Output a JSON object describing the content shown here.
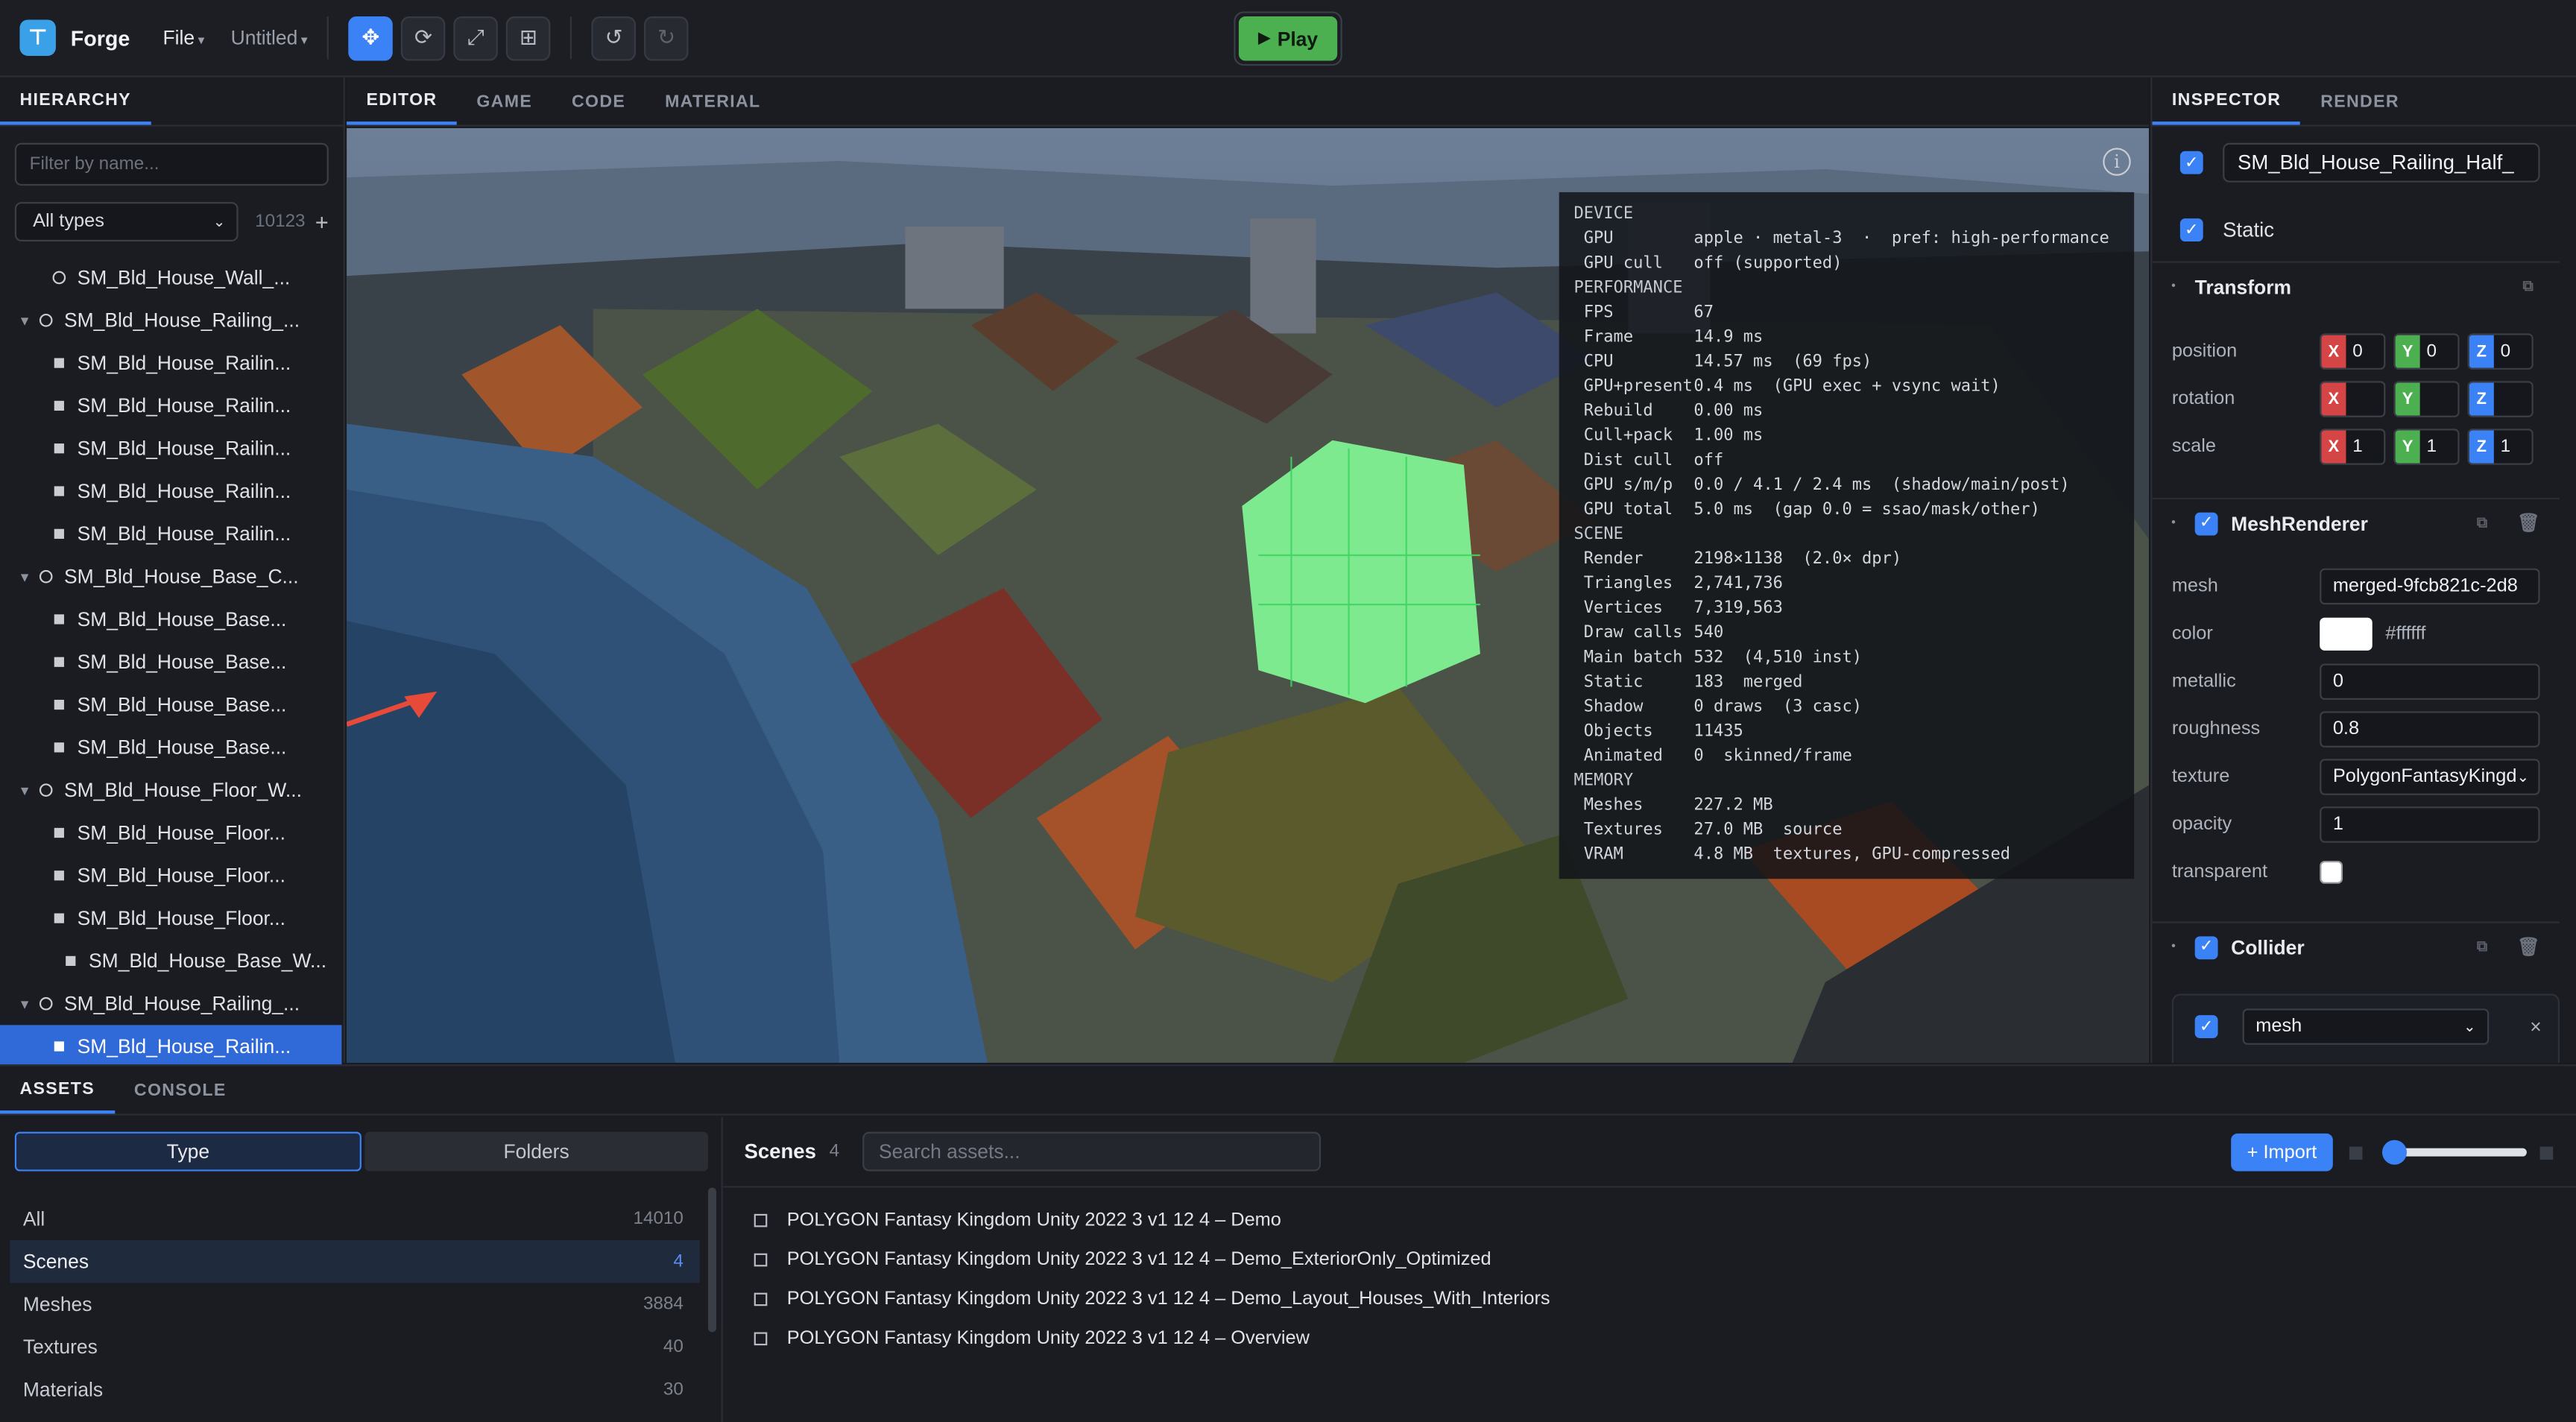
{
  "app": {
    "name": "Forge",
    "file_menu": "File",
    "document": "Untitled",
    "caret": "▾",
    "play_label": "Play",
    "play_icon": "▶",
    "tools": [
      {
        "name": "move-tool",
        "glyph": "✥",
        "active": true
      },
      {
        "name": "rotate-tool",
        "glyph": "⟳",
        "active": false
      },
      {
        "name": "scale-tool",
        "glyph": "⤢",
        "active": false
      },
      {
        "name": "rect-tool",
        "glyph": "⊞",
        "active": false
      }
    ],
    "undo": "↺",
    "redo": "↻",
    "accent": "#3b82f6",
    "play_color": "#4caf50"
  },
  "hierarchy": {
    "tab": "HIERARCHY",
    "filter_placeholder": "Filter by name...",
    "types_selected": "All types",
    "count": "10123",
    "add": "+",
    "rows": [
      {
        "label": "SM_Bld_House_Wall_...",
        "depth": 1,
        "kind": "node",
        "expanded": false
      },
      {
        "label": "SM_Bld_House_Railing_...",
        "depth": 0,
        "kind": "node",
        "expanded": true
      },
      {
        "label": "SM_Bld_House_Railin...",
        "depth": 1,
        "kind": "leaf"
      },
      {
        "label": "SM_Bld_House_Railin...",
        "depth": 1,
        "kind": "leaf"
      },
      {
        "label": "SM_Bld_House_Railin...",
        "depth": 1,
        "kind": "leaf"
      },
      {
        "label": "SM_Bld_House_Railin...",
        "depth": 1,
        "kind": "leaf"
      },
      {
        "label": "SM_Bld_House_Railin...",
        "depth": 1,
        "kind": "leaf"
      },
      {
        "label": "SM_Bld_House_Base_C...",
        "depth": 0,
        "kind": "node",
        "expanded": true
      },
      {
        "label": "SM_Bld_House_Base...",
        "depth": 1,
        "kind": "leaf"
      },
      {
        "label": "SM_Bld_House_Base...",
        "depth": 1,
        "kind": "leaf"
      },
      {
        "label": "SM_Bld_House_Base...",
        "depth": 1,
        "kind": "leaf"
      },
      {
        "label": "SM_Bld_House_Base...",
        "depth": 1,
        "kind": "leaf"
      },
      {
        "label": "SM_Bld_House_Floor_W...",
        "depth": 0,
        "kind": "node",
        "expanded": true
      },
      {
        "label": "SM_Bld_House_Floor...",
        "depth": 1,
        "kind": "leaf"
      },
      {
        "label": "SM_Bld_House_Floor...",
        "depth": 1,
        "kind": "leaf"
      },
      {
        "label": "SM_Bld_House_Floor...",
        "depth": 1,
        "kind": "leaf"
      },
      {
        "label": "SM_Bld_House_Base_W...",
        "depth": 0,
        "kind": "leaf"
      },
      {
        "label": "SM_Bld_House_Railing_...",
        "depth": 0,
        "kind": "node",
        "expanded": true
      },
      {
        "label": "SM_Bld_House_Railin...",
        "depth": 1,
        "kind": "leaf",
        "selected": true
      }
    ]
  },
  "editor": {
    "tabs": [
      "EDITOR",
      "GAME",
      "CODE",
      "MATERIAL"
    ],
    "info_icon": "i",
    "stats": [
      {
        "section": "DEVICE"
      },
      {
        "k": "GPU",
        "v": "apple · metal-3  ·  pref: high-performance"
      },
      {
        "k": "GPU cull",
        "v": "off (supported)"
      },
      {
        "section": "PERFORMANCE"
      },
      {
        "k": "FPS",
        "v": "67"
      },
      {
        "k": "Frame",
        "v": "14.9 ms"
      },
      {
        "k": "CPU",
        "v": "14.57 ms  (69 fps)"
      },
      {
        "k": "GPU+present",
        "v": "0.4 ms  (GPU exec + vsync wait)"
      },
      {
        "k": "Rebuild",
        "v": "0.00 ms"
      },
      {
        "k": "Cull+pack",
        "v": "1.00 ms"
      },
      {
        "k": "Dist cull",
        "v": "off"
      },
      {
        "k": "GPU s/m/p",
        "v": "0.0 / 4.1 / 2.4 ms  (shadow/main/post)"
      },
      {
        "k": "GPU total",
        "v": "5.0 ms  (gap 0.0 = ssao/mask/other)"
      },
      {
        "section": "SCENE"
      },
      {
        "k": "Render",
        "v": "2198×1138  (2.0× dpr)"
      },
      {
        "k": "Triangles",
        "v": "2,741,736"
      },
      {
        "k": "Vertices",
        "v": "7,319,563"
      },
      {
        "k": "Draw calls",
        "v": "540"
      },
      {
        "k": "Main batch",
        "v": "532  (4,510 inst)"
      },
      {
        "k": "Static",
        "v": "183  merged"
      },
      {
        "k": "Shadow",
        "v": "0 draws  (3 casc)"
      },
      {
        "k": "Objects",
        "v": "11435"
      },
      {
        "k": "Animated",
        "v": "0  skinned/frame"
      },
      {
        "section": "MEMORY"
      },
      {
        "k": "Meshes",
        "v": "227.2 MB"
      },
      {
        "k": "Textures",
        "v": "27.0 MB  source"
      },
      {
        "k": "VRAM",
        "v": "4.8 MB  textures, GPU-compressed"
      }
    ]
  },
  "inspector": {
    "tabs": [
      "INSPECTOR",
      "RENDER"
    ],
    "object_name": "SM_Bld_House_Railing_Half_",
    "static_label": "Static",
    "transform": {
      "title": "Transform",
      "rows": [
        {
          "label": "position",
          "x": "0",
          "y": "0",
          "z": "0"
        },
        {
          "label": "rotation",
          "x": "",
          "y": "",
          "z": ""
        },
        {
          "label": "scale",
          "x": "1",
          "y": "1",
          "z": "1"
        }
      ]
    },
    "axes": {
      "x": "X",
      "y": "Y",
      "z": "Z"
    },
    "mesh_renderer": {
      "title": "MeshRenderer",
      "mesh_label": "mesh",
      "mesh": "merged-9fcb821c-2d8",
      "color_label": "color",
      "color": "#ffffff",
      "metallic_label": "metallic",
      "metallic": "0",
      "roughness_label": "roughness",
      "roughness": "0.8",
      "texture_label": "texture",
      "texture": "PolygonFantasyKingd",
      "opacity_label": "opacity",
      "opacity": "1",
      "transparent_label": "transparent"
    },
    "collider": {
      "title": "Collider",
      "shape": "mesh",
      "remove": "×"
    }
  },
  "assets": {
    "tabs": [
      "ASSETS",
      "CONSOLE"
    ],
    "modes": [
      "Type",
      "Folders"
    ],
    "categories": [
      {
        "label": "All",
        "count": "14010"
      },
      {
        "label": "Scenes",
        "count": "4",
        "active": true
      },
      {
        "label": "Meshes",
        "count": "3884"
      },
      {
        "label": "Textures",
        "count": "40"
      },
      {
        "label": "Materials",
        "count": "30"
      }
    ],
    "section_title": "Scenes",
    "section_count": "4",
    "search_placeholder": "Search assets...",
    "import_label": "+ Import",
    "zoom_level": 0.0,
    "items": [
      "POLYGON Fantasy Kingdom Unity 2022 3 v1 12 4 – Demo",
      "POLYGON Fantasy Kingdom Unity 2022 3 v1 12 4 – Demo_ExteriorOnly_Optimized",
      "POLYGON Fantasy Kingdom Unity 2022 3 v1 12 4 – Demo_Layout_Houses_With_Interiors",
      "POLYGON Fantasy Kingdom Unity 2022 3 v1 12 4 – Overview"
    ]
  }
}
